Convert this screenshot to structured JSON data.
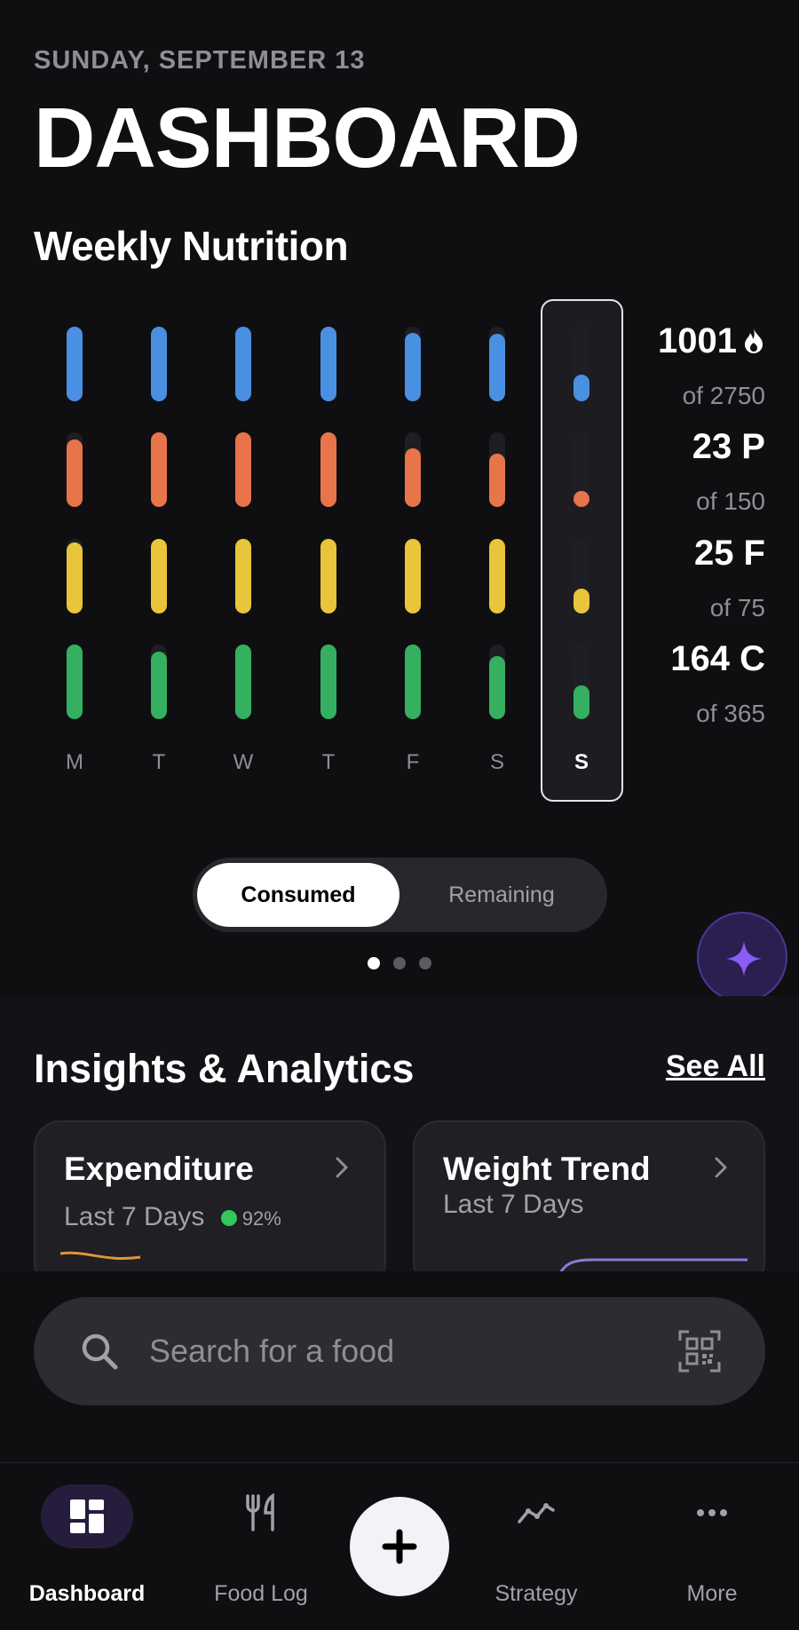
{
  "header": {
    "date": "SUNDAY, SEPTEMBER 13",
    "title": "DASHBOARD",
    "subtitle": "Weekly Nutrition"
  },
  "colors": {
    "calories": "#4a90e2",
    "protein": "#e8744a",
    "fat": "#e8c53a",
    "carbs": "#34b060",
    "accent": "#7c5cf5"
  },
  "chart_data": {
    "type": "bar",
    "categories": [
      "M",
      "T",
      "W",
      "T",
      "F",
      "S",
      "S"
    ],
    "series": [
      {
        "name": "calories",
        "values": [
          1.0,
          1.0,
          1.0,
          1.0,
          0.92,
          0.9,
          0.36
        ]
      },
      {
        "name": "protein",
        "values": [
          0.9,
          1.0,
          1.0,
          1.0,
          0.78,
          0.72,
          0.15
        ]
      },
      {
        "name": "fat",
        "values": [
          0.95,
          1.0,
          1.0,
          1.0,
          1.0,
          1.0,
          0.33
        ]
      },
      {
        "name": "carbs",
        "values": [
          1.0,
          0.9,
          1.0,
          1.0,
          1.0,
          0.85,
          0.45
        ]
      }
    ],
    "highlighted_category_index": 6
  },
  "stats": [
    {
      "value": "1001",
      "of": "of 2750",
      "icon": "flame-icon"
    },
    {
      "value": "23 P",
      "of": "of 150"
    },
    {
      "value": "25 F",
      "of": "of 75"
    },
    {
      "value": "164 C",
      "of": "of 365"
    }
  ],
  "toggle": {
    "consumed": "Consumed",
    "remaining": "Remaining",
    "selected": "consumed"
  },
  "pager": {
    "count": 3,
    "active": 0
  },
  "insights": {
    "title": "Insights & Analytics",
    "see_all": "See All",
    "cards": [
      {
        "title": "Expenditure",
        "subtitle": "Last 7 Days",
        "percent": "92%"
      },
      {
        "title": "Weight Trend",
        "subtitle": "Last 7 Days"
      }
    ]
  },
  "search": {
    "placeholder": "Search for a food"
  },
  "tabs": [
    {
      "label": "Dashboard",
      "icon": "dashboard-icon",
      "active": true
    },
    {
      "label": "Food Log",
      "icon": "fork-knife-icon"
    },
    {
      "label": "",
      "icon": "plus-icon"
    },
    {
      "label": "Strategy",
      "icon": "trend-line-icon"
    },
    {
      "label": "More",
      "icon": "more-dots-icon"
    }
  ]
}
